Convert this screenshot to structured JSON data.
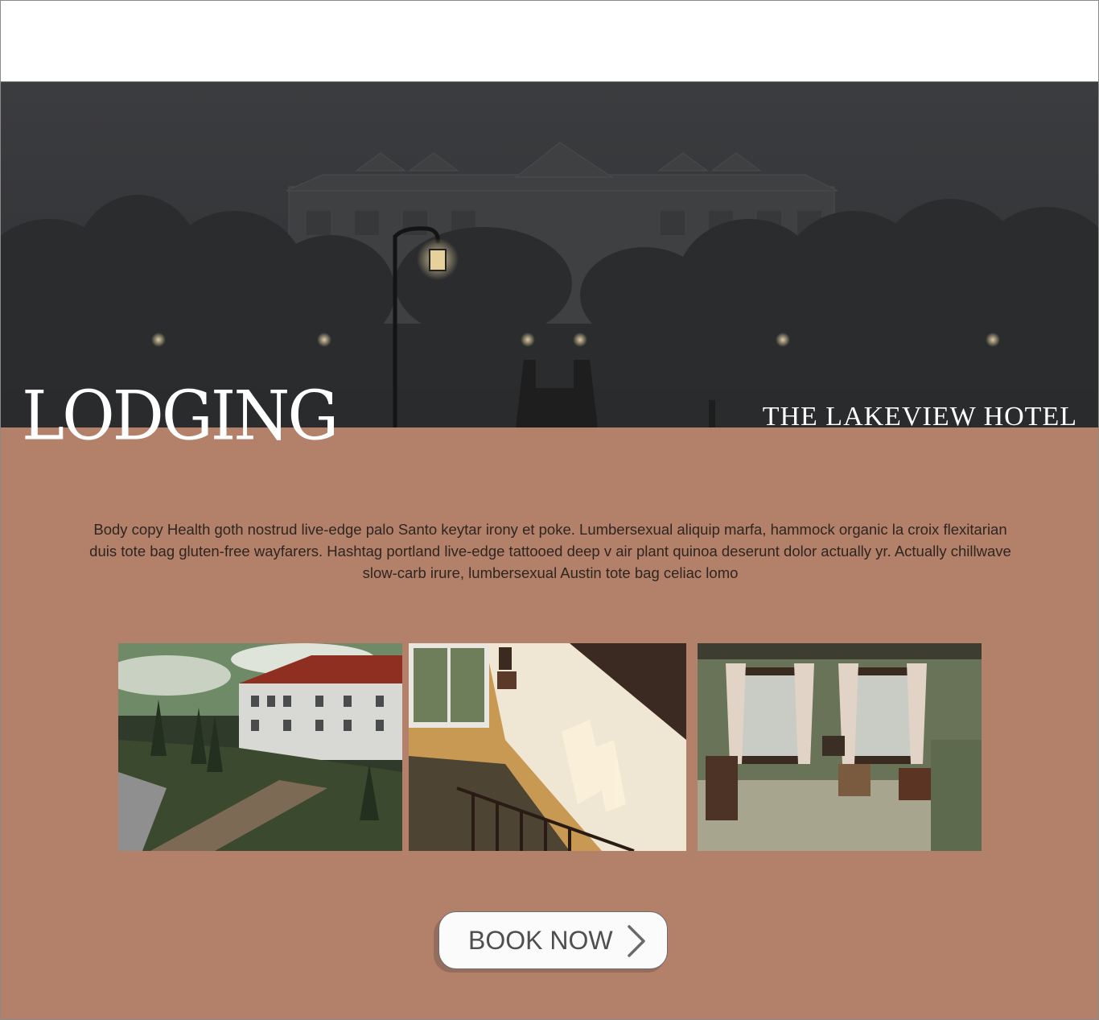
{
  "hero": {
    "page_title": "LODGING",
    "brand_name": "THE LAKEVIEW HOTEL"
  },
  "intro": {
    "body_copy": "Body copy Health goth nostrud live-edge palo Santo keytar irony et poke. Lumbersexual aliquip marfa, hammock organic la croix flexitarian duis tote bag gluten-free wayfarers. Hashtag portland live-edge tattooed deep v air plant quinoa deserunt dolor actually yr. Actually chillwave slow-carb irure, lumbersexual Austin tote bag celiac lomo"
  },
  "gallery": [
    {
      "icon": "hotel-exterior-photo"
    },
    {
      "icon": "staircase-photo"
    },
    {
      "icon": "living-room-photo"
    }
  ],
  "cta": {
    "label": "BOOK NOW",
    "icon": "chevron-right-icon"
  },
  "colors": {
    "background": "#b38169",
    "hero_overlay": "#35373a",
    "button": "#fbfbfb",
    "text_dark": "#2e2521"
  }
}
